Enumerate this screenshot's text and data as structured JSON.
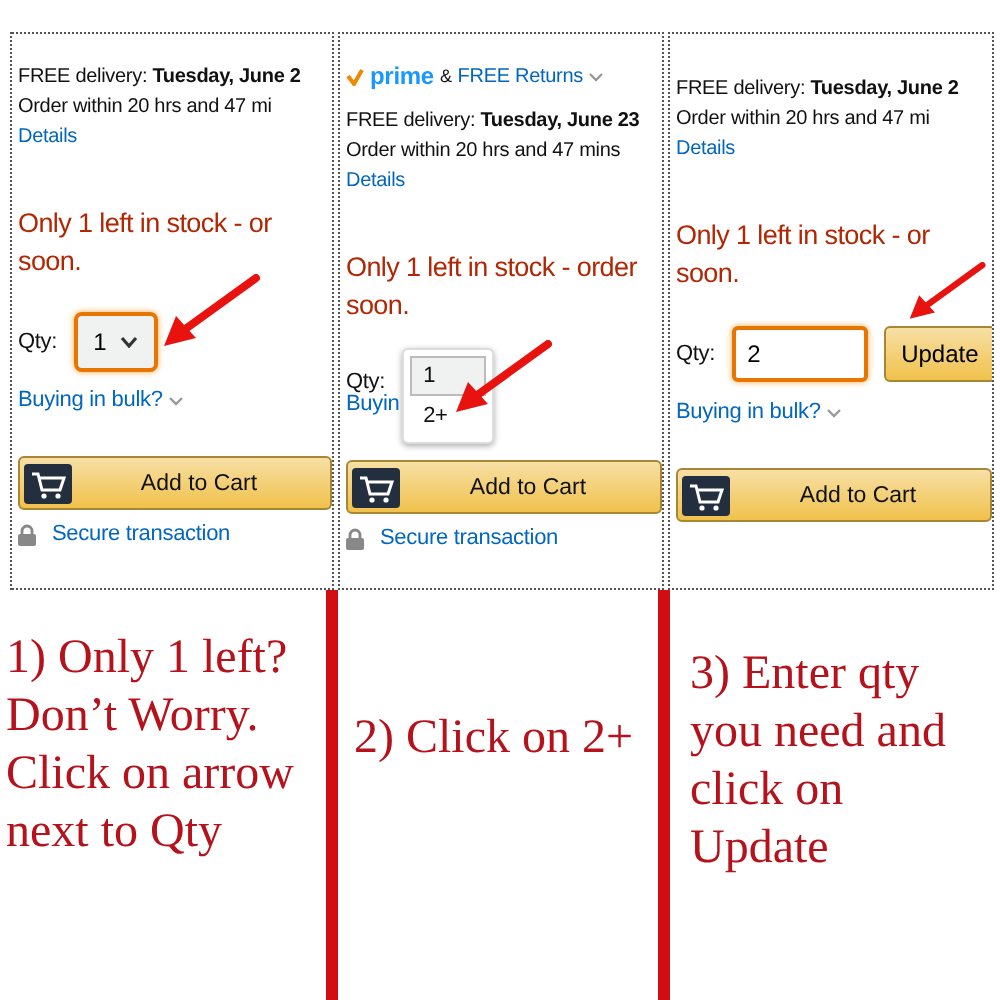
{
  "panels": [
    {
      "delivery": "FREE delivery: **Tuesday, June 2**",
      "order_time": "Order within 20 hrs and 47 mi",
      "details_link": "Details",
      "stock_lines": [
        "Only 1 left in stock - or",
        "soon."
      ],
      "qty_label": "Qty:",
      "qty_control": {
        "kind": "select",
        "value": "1"
      },
      "bulk_link": "Buying in bulk?",
      "add_to_cart": "Add to Cart",
      "secure_link": "Secure transaction",
      "caption": "1) Only 1 left? Don’t Worry. Click on arrow next to Qty"
    },
    {
      "prime": {
        "logo": "prime",
        "and_text": "&",
        "returns_link": "FREE Returns"
      },
      "delivery": "FREE delivery: **Tuesday, June 23**",
      "order_time": "Order within 20 hrs and 47 mins",
      "details_link": "Details",
      "stock_lines": [
        "Only 1 left in stock - order",
        "soon."
      ],
      "qty_label": "Qty:",
      "qty_control": {
        "kind": "dropdown",
        "options": [
          {
            "label": "1",
            "selected": true
          },
          {
            "label": "2+",
            "selected": false
          }
        ]
      },
      "bulk_link": "Buyin",
      "add_to_cart": "Add to Cart",
      "secure_link": "Secure transaction",
      "caption": "2) Click on 2+"
    },
    {
      "delivery": "FREE delivery: **Tuesday, June 2**",
      "order_time": "Order within 20 hrs and 47 mi",
      "details_link": "Details",
      "stock_lines": [
        "Only 1 left in stock - or",
        "soon."
      ],
      "qty_label": "Qty:",
      "qty_control": {
        "kind": "input",
        "value": "2",
        "button": "Update"
      },
      "bulk_link": "Buying in bulk?",
      "add_to_cart": "Add to Cart",
      "caption": "3) Enter qty you need and click on Update"
    }
  ]
}
